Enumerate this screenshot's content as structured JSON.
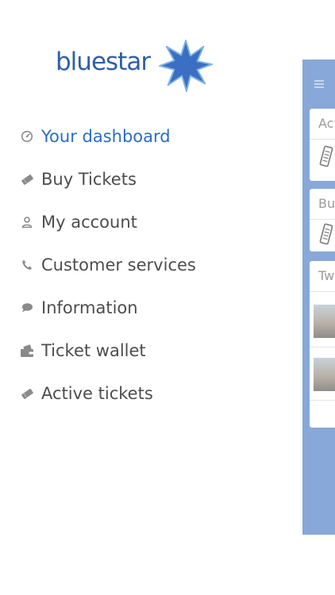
{
  "logo": {
    "text": "bluestar",
    "color": "#2f5fa8",
    "star_color": "#3a6fc4"
  },
  "menu": {
    "items": [
      {
        "label": "Your dashboard",
        "icon": "dashboard-gauge-icon",
        "active": true
      },
      {
        "label": "Buy Tickets",
        "icon": "ticket-icon",
        "active": false
      },
      {
        "label": "My account",
        "icon": "user-icon",
        "active": false
      },
      {
        "label": "Customer services",
        "icon": "phone-icon",
        "active": false
      },
      {
        "label": "Information",
        "icon": "speech-bubble-icon",
        "active": false
      },
      {
        "label": "Ticket wallet",
        "icon": "wallet-icon",
        "active": false
      },
      {
        "label": "Active tickets",
        "icon": "ticket-icon",
        "active": false
      }
    ],
    "active_color": "#2a6dc8",
    "text_color": "#4d4d4d",
    "icon_color": "#8a8a8a"
  },
  "background_app": {
    "panel_color": "#87a8d8",
    "cards": [
      {
        "title": "Act"
      },
      {
        "title": "Buy"
      },
      {
        "title": "Tw"
      }
    ]
  }
}
